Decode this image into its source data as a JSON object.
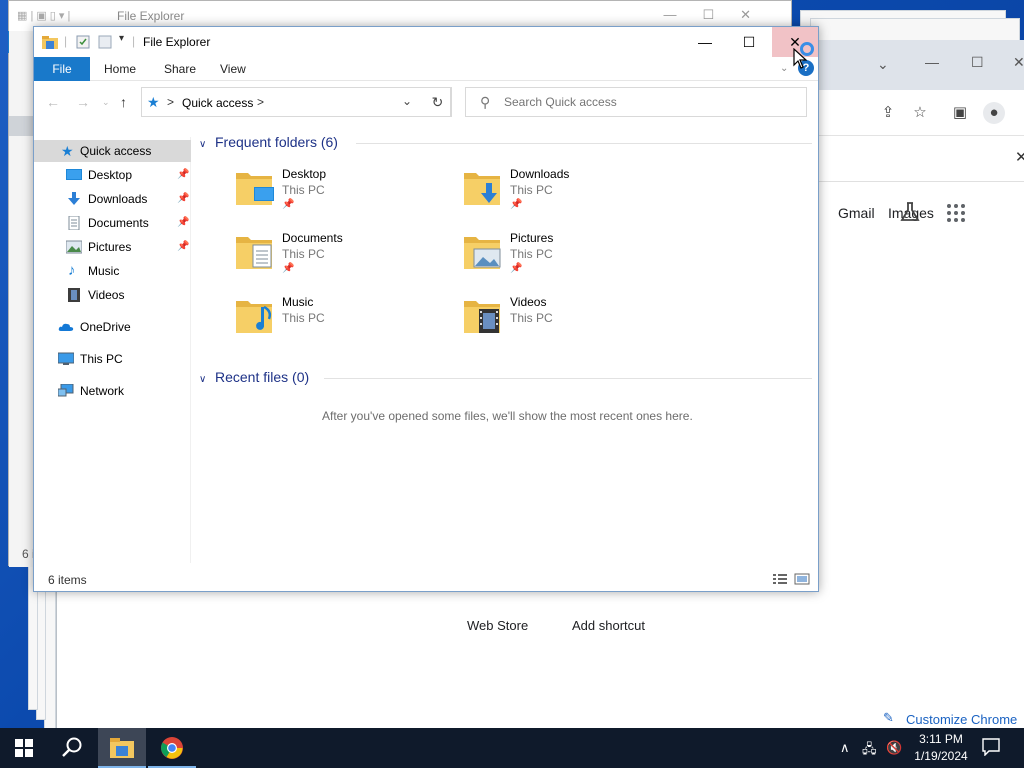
{
  "explorer": {
    "title": "File Explorer",
    "window_controls": {
      "minimize": "—",
      "maximize": "☐",
      "close": "✕"
    },
    "ribbon_tabs": [
      "File",
      "Home",
      "Share",
      "View"
    ],
    "help": "?",
    "address": {
      "crumb": "Quick access",
      "separator": ">"
    },
    "search_placeholder": "Search Quick access",
    "nav_pane": [
      {
        "label": "Quick access",
        "icon": "star-icon",
        "pinned": false
      },
      {
        "label": "Desktop",
        "icon": "desktop-icon",
        "pinned": true
      },
      {
        "label": "Downloads",
        "icon": "download-icon",
        "pinned": true
      },
      {
        "label": "Documents",
        "icon": "documents-icon",
        "pinned": true
      },
      {
        "label": "Pictures",
        "icon": "pictures-icon",
        "pinned": true
      },
      {
        "label": "Music",
        "icon": "music-icon",
        "pinned": false
      },
      {
        "label": "Videos",
        "icon": "videos-icon",
        "pinned": false
      },
      {
        "label": "OneDrive",
        "icon": "onedrive-icon",
        "pinned": false
      },
      {
        "label": "This PC",
        "icon": "this-pc-icon",
        "pinned": false
      },
      {
        "label": "Network",
        "icon": "network-icon",
        "pinned": false
      }
    ],
    "frequent_header": "Frequent folders (6)",
    "folders": [
      {
        "name": "Desktop",
        "location": "This PC",
        "pinned": true,
        "overlay": "desktop"
      },
      {
        "name": "Downloads",
        "location": "This PC",
        "pinned": true,
        "overlay": "download"
      },
      {
        "name": "Documents",
        "location": "This PC",
        "pinned": true,
        "overlay": "documents"
      },
      {
        "name": "Pictures",
        "location": "This PC",
        "pinned": true,
        "overlay": "pictures"
      },
      {
        "name": "Music",
        "location": "This PC",
        "pinned": false,
        "overlay": "music"
      },
      {
        "name": "Videos",
        "location": "This PC",
        "pinned": false,
        "overlay": "videos"
      }
    ],
    "recent_header": "Recent files (0)",
    "recent_empty_message": "After you've opened some files, we'll show the most recent ones here.",
    "status": "6 items"
  },
  "back_explorer": {
    "title": "File Explorer",
    "file_tab": "F",
    "status": "6 i"
  },
  "chrome": {
    "links": {
      "gmail": "Gmail",
      "images": "Images"
    },
    "shortcuts": [
      "Web Store",
      "Add shortcut"
    ],
    "customize": "Customize Chrome"
  },
  "taskbar": {
    "time": "3:11 PM",
    "date": "1/19/2024",
    "apps": [
      "file-explorer",
      "chrome"
    ]
  },
  "colors": {
    "accent": "#1979ca",
    "group_header": "#1e3287",
    "folder": "#f3c75f",
    "taskbar": "#0f1a2b"
  }
}
